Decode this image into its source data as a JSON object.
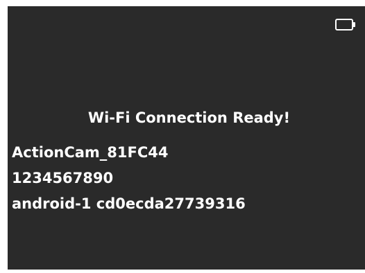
{
  "screen": {
    "background_color": "#2a2a2a",
    "text_color": "#ffffff",
    "battery_icon": "battery-icon",
    "title": "Wi-Fi Connection  Ready!",
    "ssid": "ActionCam_81FC44",
    "password": "1234567890",
    "device": "android-1 cd0ecda27739316"
  }
}
